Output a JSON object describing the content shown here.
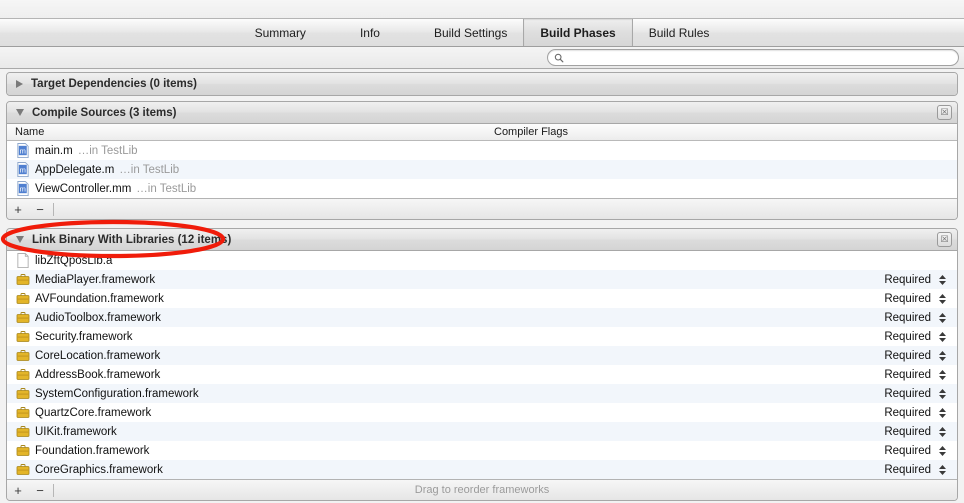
{
  "tabs": [
    {
      "label": "Summary",
      "selected": false
    },
    {
      "label": "Info",
      "selected": false
    },
    {
      "label": "Build Settings",
      "selected": false
    },
    {
      "label": "Build Phases",
      "selected": true
    },
    {
      "label": "Build Rules",
      "selected": false
    }
  ],
  "search": {
    "value": "",
    "placeholder": "",
    "icon": "search-icon"
  },
  "phases": [
    {
      "title": "Target Dependencies (0 items)",
      "expanded": false,
      "close_icon": "☒"
    },
    {
      "title": "Compile Sources (3 items)",
      "expanded": true,
      "close_icon": "☒",
      "columns": {
        "name": "Name",
        "flags": "Compiler Flags"
      },
      "rows": [
        {
          "icon": "objc-source-icon",
          "name": "main.m",
          "location": "…in TestLib"
        },
        {
          "icon": "objc-source-icon",
          "name": "AppDelegate.m",
          "location": "…in TestLib"
        },
        {
          "icon": "objcpp-source-icon",
          "name": "ViewController.mm",
          "location": "…in TestLib"
        }
      ],
      "footer": {
        "add": "+",
        "remove": "−",
        "hint": ""
      }
    },
    {
      "title": "Link Binary With Libraries (12 items)",
      "expanded": true,
      "close_icon": "☒",
      "rows": [
        {
          "icon": "static-library-icon",
          "name": "libZftQposLib.a",
          "status": ""
        },
        {
          "icon": "framework-icon",
          "name": "MediaPlayer.framework",
          "status": "Required"
        },
        {
          "icon": "framework-icon",
          "name": "AVFoundation.framework",
          "status": "Required"
        },
        {
          "icon": "framework-icon",
          "name": "AudioToolbox.framework",
          "status": "Required"
        },
        {
          "icon": "framework-icon",
          "name": "Security.framework",
          "status": "Required"
        },
        {
          "icon": "framework-icon",
          "name": "CoreLocation.framework",
          "status": "Required"
        },
        {
          "icon": "framework-icon",
          "name": "AddressBook.framework",
          "status": "Required"
        },
        {
          "icon": "framework-icon",
          "name": "SystemConfiguration.framework",
          "status": "Required"
        },
        {
          "icon": "framework-icon",
          "name": "QuartzCore.framework",
          "status": "Required"
        },
        {
          "icon": "framework-icon",
          "name": "UIKit.framework",
          "status": "Required"
        },
        {
          "icon": "framework-icon",
          "name": "Foundation.framework",
          "status": "Required"
        },
        {
          "icon": "framework-icon",
          "name": "CoreGraphics.framework",
          "status": "Required"
        }
      ],
      "footer": {
        "add": "+",
        "remove": "−",
        "hint": "Drag to reorder frameworks"
      }
    }
  ],
  "annotation": {
    "shape": "ellipse",
    "color": "#f01c0a",
    "target": "Link Binary With Libraries (12 items)"
  },
  "colors": {
    "alt_row": "#f2f6fb",
    "framework_icon": "#e3b529",
    "source_icon": "#4f7fd0",
    "annotation_red": "#f01c0a"
  }
}
